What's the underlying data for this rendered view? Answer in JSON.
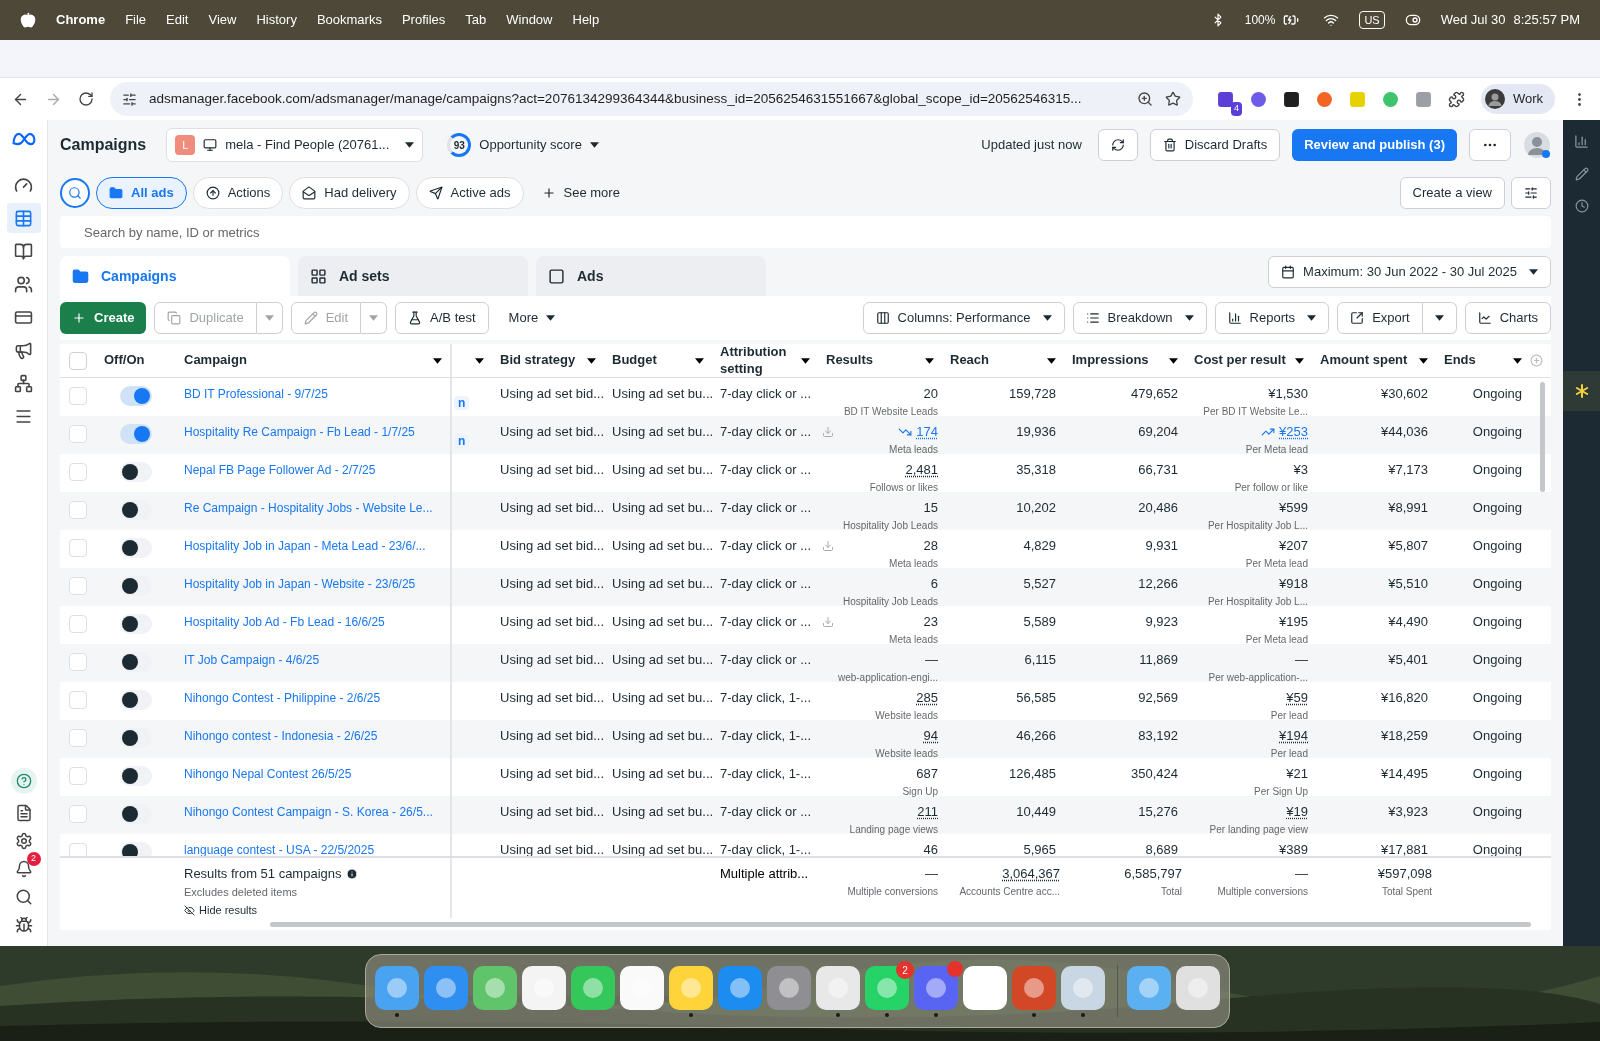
{
  "menubar": {
    "app": "Chrome",
    "menus": [
      "File",
      "Edit",
      "View",
      "History",
      "Bookmarks",
      "Profiles",
      "Tab",
      "Window",
      "Help"
    ],
    "battery": "100%",
    "input": "US",
    "date": "Wed Jul 30",
    "time": "8:25:57 PM"
  },
  "browser": {
    "url": "adsmanager.facebook.com/adsmanager/manage/campaigns?act=2076134299364344&business_id=2056254631551667&global_scope_id=20562546315...",
    "extension_badge": "4",
    "profile": "Work"
  },
  "nav": {
    "items": [
      {
        "selected": false
      },
      {
        "selected": true
      },
      {
        "selected": false
      },
      {
        "selected": false
      },
      {
        "selected": false
      },
      {
        "selected": false
      },
      {
        "selected": false
      },
      {
        "selected": false
      }
    ],
    "notification_count": "2"
  },
  "header": {
    "title": "Campaigns",
    "account_initial": "L",
    "account": "mela - Find People (20761...",
    "score": "93",
    "score_label": "Opportunity score",
    "updated": "Updated just now",
    "buttons": [
      {
        "label": "Discard Drafts",
        "kind": "secondary"
      },
      {
        "label": "Review and publish (3)",
        "kind": "primary"
      }
    ]
  },
  "filters": [
    {
      "label": "All ads",
      "selected": true
    },
    {
      "label": "Actions",
      "selected": false
    },
    {
      "label": "Had delivery",
      "selected": false
    },
    {
      "label": "Active ads",
      "selected": false
    }
  ],
  "see_more": "See more",
  "create_view": "Create a view",
  "search": {
    "placeholder": "Search by name, ID or metrics"
  },
  "tabs": [
    {
      "label": "Campaigns",
      "selected": true
    },
    {
      "label": "Ad sets",
      "selected": false
    },
    {
      "label": "Ads",
      "selected": false
    }
  ],
  "date_range": "Maximum: 30 Jun 2022 - 30 Jul 2025",
  "toolbar_left": [
    {
      "label": "Create",
      "kind": "primary",
      "disabled": false
    },
    {
      "label": "Duplicate",
      "kind": "split",
      "disabled": true
    },
    {
      "label": "Edit",
      "kind": "split",
      "disabled": true
    },
    {
      "label": "A/B test",
      "kind": "plain",
      "disabled": false
    },
    {
      "label": "More",
      "kind": "menu",
      "disabled": false
    }
  ],
  "toolbar_right": [
    {
      "label": "Columns: Performance",
      "kind": "menu"
    },
    {
      "label": "Breakdown",
      "kind": "menu"
    },
    {
      "label": "Reports",
      "kind": "menu"
    },
    {
      "label": "Export",
      "kind": "split"
    },
    {
      "label": "Charts",
      "kind": "plain"
    }
  ],
  "table": {
    "select_all_checked": false,
    "columns": [
      {
        "label": "Off/On",
        "menu": false
      },
      {
        "label": "Campaign",
        "menu": true
      },
      {
        "menu": true
      },
      {
        "label": "Bid strategy",
        "menu": true
      },
      {
        "label": "Budget",
        "menu": true
      },
      {
        "label": "Attribution setting",
        "menu": true
      },
      {
        "label": "Results",
        "menu": true
      },
      {
        "label": "Reach",
        "menu": true
      },
      {
        "label": "Impressions",
        "menu": true
      },
      {
        "label": "Cost per result",
        "menu": true
      },
      {
        "label": "Amount spent",
        "menu": true
      },
      {
        "label": "Ends",
        "menu": true
      }
    ],
    "rows": [
      {
        "checked": false,
        "on": true,
        "campaign": "BD IT Professional - 9/7/25",
        "column_3": "n",
        "bid": "Using ad set bid...",
        "budget": "Using ad set bu...",
        "attribution": "7-day click or ...",
        "results": {
          "value": "20",
          "sub": "BD IT Website Leads"
        },
        "reach": "159,728",
        "impressions": "479,652",
        "cost": {
          "value": "¥1,530",
          "sub": "Per BD IT Website Le..."
        },
        "spent": "¥30,602",
        "ends": "Ongoing"
      },
      {
        "checked": false,
        "on": true,
        "campaign": "Hospitality Re Campaign - Fb Lead - 1/7/25",
        "column_3": "n",
        "bid": "Using ad set bid...",
        "budget": "Using ad set bu...",
        "attribution": "7-day click or ...",
        "results": {
          "value": "174",
          "sub": "Meta leads",
          "underlined": true,
          "trending_down": true,
          "download": true
        },
        "reach": "19,936",
        "impressions": "69,204",
        "cost": {
          "value": "¥253",
          "sub": "Per Meta lead",
          "underlined": true,
          "trending_up": true
        },
        "spent": "¥44,036",
        "ends": "Ongoing"
      },
      {
        "checked": false,
        "on": false,
        "campaign": "Nepal FB Page Follower Ad - 2/7/25",
        "bid": "Using ad set bid...",
        "budget": "Using ad set bu...",
        "attribution": "7-day click or ...",
        "results": {
          "value": "2,481",
          "sub": "Follows or likes",
          "underlined": true
        },
        "reach": "35,318",
        "impressions": "66,731",
        "cost": {
          "value": "¥3",
          "sub": "Per follow or like"
        },
        "spent": "¥7,173",
        "ends": "Ongoing"
      },
      {
        "checked": false,
        "on": false,
        "campaign": "Re Campaign - Hospitality Jobs - Website Le...",
        "bid": "Using ad set bid...",
        "budget": "Using ad set bu...",
        "attribution": "7-day click or ...",
        "results": {
          "value": "15",
          "sub": "Hospitality Job Leads"
        },
        "reach": "10,202",
        "impressions": "20,486",
        "cost": {
          "value": "¥599",
          "sub": "Per Hospitality Job L..."
        },
        "spent": "¥8,991",
        "ends": "Ongoing"
      },
      {
        "checked": false,
        "on": false,
        "campaign": "Hospitality Job in Japan - Meta Lead - 23/6/...",
        "bid": "Using ad set bid...",
        "budget": "Using ad set bu...",
        "attribution": "7-day click or ...",
        "results": {
          "value": "28",
          "sub": "Meta leads",
          "download": true
        },
        "reach": "4,829",
        "impressions": "9,931",
        "cost": {
          "value": "¥207",
          "sub": "Per Meta lead"
        },
        "spent": "¥5,807",
        "ends": "Ongoing"
      },
      {
        "checked": false,
        "on": false,
        "campaign": "Hospitality Job in Japan - Website - 23/6/25",
        "bid": "Using ad set bid...",
        "budget": "Using ad set bu...",
        "attribution": "7-day click or ...",
        "results": {
          "value": "6",
          "sub": "Hospitality Job Leads"
        },
        "reach": "5,527",
        "impressions": "12,266",
        "cost": {
          "value": "¥918",
          "sub": "Per Hospitality Job L..."
        },
        "spent": "¥5,510",
        "ends": "Ongoing"
      },
      {
        "checked": false,
        "on": false,
        "campaign": "Hospitality Job Ad - Fb Lead - 16/6/25",
        "bid": "Using ad set bid...",
        "budget": "Using ad set bu...",
        "attribution": "7-day click or ...",
        "results": {
          "value": "23",
          "sub": "Meta leads",
          "download": true
        },
        "reach": "5,589",
        "impressions": "9,923",
        "cost": {
          "value": "¥195",
          "sub": "Per Meta lead"
        },
        "spent": "¥4,490",
        "ends": "Ongoing"
      },
      {
        "checked": false,
        "on": false,
        "campaign": "IT Job Campaign - 4/6/25",
        "bid": "Using ad set bid...",
        "budget": "Using ad set bu...",
        "attribution": "7-day click or ...",
        "results": {
          "value": "—",
          "sub": "web-application-engi..."
        },
        "reach": "6,115",
        "impressions": "11,869",
        "cost": {
          "value": "—",
          "sub": "Per web-application-..."
        },
        "spent": "¥5,401",
        "ends": "Ongoing"
      },
      {
        "checked": false,
        "on": false,
        "campaign": "Nihongo Contest - Philippine - 2/6/25",
        "bid": "Using ad set bid...",
        "budget": "Using ad set bu...",
        "attribution": "7-day click, 1-...",
        "results": {
          "value": "285",
          "sub": "Website leads",
          "underlined": true
        },
        "reach": "56,585",
        "impressions": "92,569",
        "cost": {
          "value": "¥59",
          "sub": "Per lead",
          "underlined": true
        },
        "spent": "¥16,820",
        "ends": "Ongoing"
      },
      {
        "checked": false,
        "on": false,
        "campaign": "Nihongo contest - Indonesia - 2/6/25",
        "bid": "Using ad set bid...",
        "budget": "Using ad set bu...",
        "attribution": "7-day click, 1-...",
        "results": {
          "value": "94",
          "sub": "Website leads",
          "underlined": true
        },
        "reach": "46,266",
        "impressions": "83,192",
        "cost": {
          "value": "¥194",
          "sub": "Per lead",
          "underlined": true
        },
        "spent": "¥18,259",
        "ends": "Ongoing"
      },
      {
        "checked": false,
        "on": false,
        "campaign": "Nihongo Nepal Contest 26/5/25",
        "bid": "Using ad set bid...",
        "budget": "Using ad set bu...",
        "attribution": "7-day click, 1-...",
        "results": {
          "value": "687",
          "sub": "Sign Up"
        },
        "reach": "126,485",
        "impressions": "350,424",
        "cost": {
          "value": "¥21",
          "sub": "Per Sign Up"
        },
        "spent": "¥14,495",
        "ends": "Ongoing"
      },
      {
        "checked": false,
        "on": false,
        "campaign": "Nihongo Contest Campaign - S. Korea - 26/5...",
        "bid": "Using ad set bid...",
        "budget": "Using ad set bu...",
        "attribution": "7-day click or ...",
        "results": {
          "value": "211",
          "sub": "Landing page views",
          "underlined": true
        },
        "reach": "10,449",
        "impressions": "15,276",
        "cost": {
          "value": "¥19",
          "sub": "Per landing page view",
          "underlined": true
        },
        "spent": "¥3,923",
        "ends": "Ongoing"
      },
      {
        "checked": false,
        "on": false,
        "campaign": "language contest - USA - 22/5/2025",
        "bid": "Using ad set bid...",
        "budget": "Using ad set bu...",
        "attribution": "7-day click, 1-...",
        "results": {
          "value": "46"
        },
        "reach": "5,965",
        "impressions": "8,689",
        "cost": {
          "value": "¥389"
        },
        "spent": "¥17,881",
        "ends": "Ongoing"
      }
    ],
    "footer": {
      "title": "Results from 51 campaigns",
      "note": "Excludes deleted items",
      "hide": "Hide results",
      "attribution": "Multiple attrib...",
      "results": {
        "value": "—",
        "sub": "Multiple conversions"
      },
      "reach": {
        "value": "3,064,367",
        "sub": "Accounts Centre acc...",
        "underlined": true
      },
      "impressions": {
        "value": "6,585,797",
        "sub": "Total"
      },
      "cost": {
        "value": "—",
        "sub": "Multiple conversions"
      },
      "spent": {
        "value": "¥597,098",
        "sub": "Total Spent"
      }
    }
  },
  "dock": [
    {
      "color": "#4aa3f0",
      "running": true
    },
    {
      "color": "#2f8ff0",
      "running": false
    },
    {
      "color": "#5fc46a",
      "running": false
    },
    {
      "color": "#f4f4f4",
      "running": false
    },
    {
      "color": "#34c759",
      "running": false
    },
    {
      "color": "#fafafa",
      "running": false
    },
    {
      "color": "#ffd43b",
      "running": true
    },
    {
      "color": "#1c8cf0",
      "running": false
    },
    {
      "color": "#8e8e93",
      "running": false
    },
    {
      "color": "#e8e8e8",
      "running": true
    },
    {
      "color": "#25d366",
      "running": true,
      "badge": "2"
    },
    {
      "color": "#5865f2",
      "running": true,
      "dot": true
    },
    {
      "color": "#ffffff",
      "running": false
    },
    {
      "color": "#d24726",
      "running": true
    },
    {
      "color": "#c9d6e3",
      "running": true
    },
    {
      "color": "#5ab0f0",
      "running": false,
      "separator": true
    },
    {
      "color": "#e0e0e0",
      "running": false
    }
  ]
}
